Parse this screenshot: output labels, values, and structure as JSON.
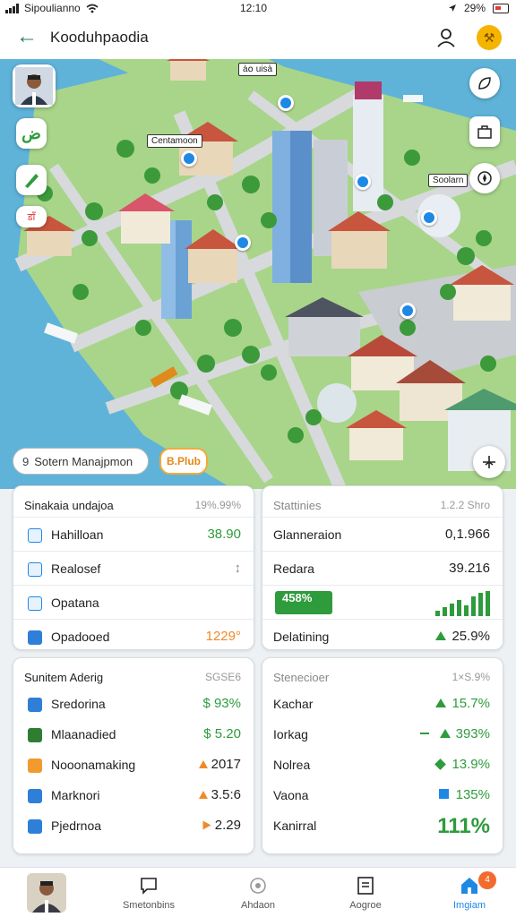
{
  "status": {
    "carrier": "Sipoulianno",
    "time": "12:10",
    "battery": "29%"
  },
  "header": {
    "title": "Kooduhpaodia",
    "badge_icon": "shield-badge-icon"
  },
  "map": {
    "labels": [
      "Centamoon",
      "à໐ uisà",
      "Soolarn"
    ],
    "left_tools": [
      "avatar",
      "flag-icon",
      "pen-icon",
      "tag-icon"
    ],
    "left_tool_text": "डाँ",
    "right_tools": [
      "leaf-icon",
      "bag-icon",
      "compass-icon"
    ]
  },
  "system_pill": {
    "number": "9",
    "label": "Sotern Manajpmon"
  },
  "add_pill": {
    "label": "B.Plub"
  },
  "card1": {
    "header": "Sinakaia undajoa",
    "header_value": "19%.99%",
    "rows": [
      {
        "label": "Hahilloan",
        "value": "38.90",
        "color": "green"
      },
      {
        "label": "Realosef",
        "value": "↕",
        "color": "dark"
      },
      {
        "label": "Opatana",
        "value": "",
        "color": "dark"
      },
      {
        "label": "Opadooed",
        "value": "1229°",
        "color": "orange"
      }
    ]
  },
  "card2": {
    "header": "Stattinies",
    "header_value": "1.2.2 Shro",
    "rows": [
      {
        "label": "Glanneraion",
        "value": "0,1.966"
      },
      {
        "label": "Redara",
        "value": "39.216"
      },
      {
        "label": "458%",
        "value": ""
      },
      {
        "label": "Delatining",
        "value": "25.9%"
      }
    ]
  },
  "card3": {
    "header": "Sunitem Aderig",
    "header_value": "SGSE6",
    "rows": [
      {
        "label": "Sredorina",
        "value": "$ 93%",
        "color": "green"
      },
      {
        "label": "Mlaanadied",
        "value": "$ 5.20",
        "color": "green"
      },
      {
        "label": "Nooonamaking",
        "value": "2017",
        "color": "dark"
      },
      {
        "label": "Marknori",
        "value": "3.5:6",
        "color": "dark"
      },
      {
        "label": "Pjedrnoa",
        "value": "2.29",
        "color": "dark"
      }
    ]
  },
  "card4": {
    "header": "Stenecioer",
    "header_value": "1×S.9%",
    "rows": [
      {
        "label": "Kachar",
        "value": "15.7%"
      },
      {
        "label": "Iorkag",
        "value": "393%"
      },
      {
        "label": "Nolrea",
        "value": "13.9%"
      },
      {
        "label": "Vaona",
        "value": "135%"
      },
      {
        "label": "Kanirral",
        "value": "111%"
      }
    ]
  },
  "nav": {
    "items": [
      "Smetonbins",
      "Ahdaon",
      "Aogroe",
      "Imgiam"
    ],
    "badge": "4"
  },
  "colors": {
    "accent": "#1e88e5",
    "positive": "#2e9b3c",
    "warning": "#ef8a2a"
  }
}
